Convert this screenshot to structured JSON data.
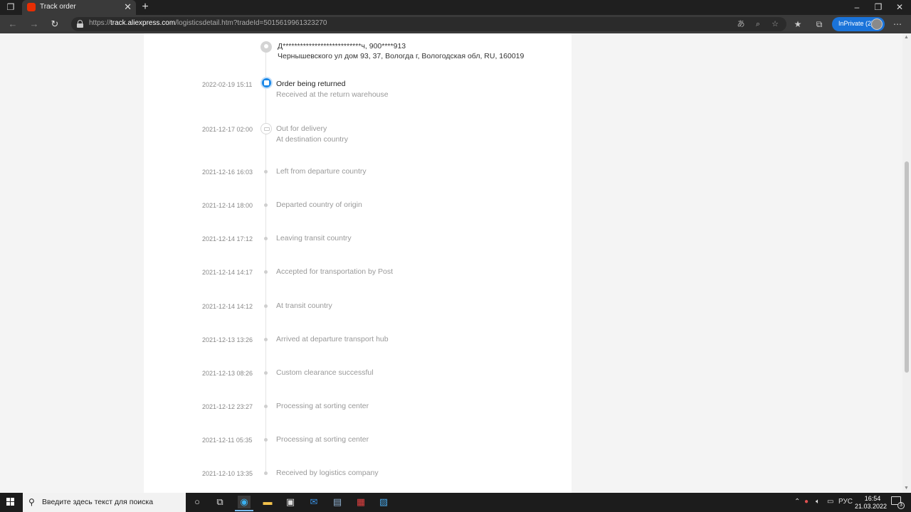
{
  "browser": {
    "tab": {
      "title": "Track order"
    },
    "url": {
      "prefix": "https://",
      "domain": "track.aliexpress.com",
      "path": "/logisticsdetail.htm?tradeId=5015619961323270"
    },
    "inprivate_label": "InPrivate (2)"
  },
  "address": {
    "line1": "Д***************************ч,  900****913",
    "line2": "Чернышевского ул дом 93, 37,  Вологда г,  Вологодская обл,  RU,  160019"
  },
  "events": [
    {
      "time": "2022-02-19 15:11",
      "title": "Order being returned",
      "subtitle": "Received at the return warehouse",
      "state": "current"
    },
    {
      "time": "2021-12-17 02:00",
      "title": "Out for delivery",
      "subtitle": "At destination country",
      "state": "stage"
    },
    {
      "time": "2021-12-16 16:03",
      "title": "Left from departure country",
      "subtitle": "",
      "state": "normal"
    },
    {
      "time": "2021-12-14 18:00",
      "title": "Departed country of origin",
      "subtitle": "",
      "state": "normal"
    },
    {
      "time": "2021-12-14 17:12",
      "title": "Leaving transit country",
      "subtitle": "",
      "state": "normal"
    },
    {
      "time": "2021-12-14 14:17",
      "title": "Accepted for transportation by Post",
      "subtitle": "",
      "state": "normal"
    },
    {
      "time": "2021-12-14 14:12",
      "title": "At transit country",
      "subtitle": "",
      "state": "normal"
    },
    {
      "time": "2021-12-13 13:26",
      "title": "Arrived at departure transport hub",
      "subtitle": "",
      "state": "normal"
    },
    {
      "time": "2021-12-13 08:26",
      "title": "Custom clearance successful",
      "subtitle": "",
      "state": "normal"
    },
    {
      "time": "2021-12-12 23:27",
      "title": "Processing at sorting center",
      "subtitle": "",
      "state": "normal"
    },
    {
      "time": "2021-12-11 05:35",
      "title": "Processing at sorting center",
      "subtitle": "",
      "state": "normal"
    },
    {
      "time": "2021-12-10 13:35",
      "title": "Received by logistics company",
      "subtitle": "",
      "state": "normal"
    }
  ],
  "taskbar": {
    "search_placeholder": "Введите здесь текст для поиска",
    "language": "РУС",
    "time": "16:54",
    "date": "21.03.2022",
    "notification_count": "3"
  },
  "colors": {
    "accent": "#1a88e8",
    "inprivate": "#1a73d9",
    "aliexpress": "#e62e04"
  },
  "icons": {
    "address": "location-pin-icon",
    "current": "package-icon",
    "stage": "truck-icon"
  }
}
